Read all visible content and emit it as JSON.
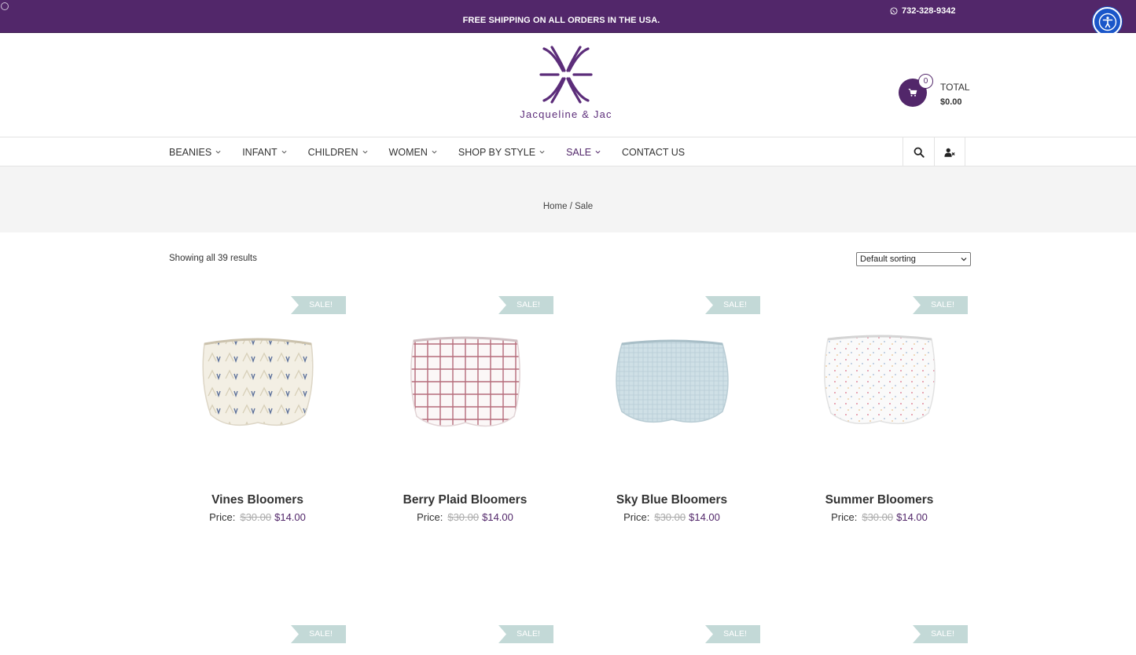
{
  "topbar": {
    "promo": "FREE SHIPPING ON ALL ORDERS IN THE USA.",
    "phone": "732-328-9342",
    "phone_icon": "whatsapp-icon",
    "background": "#52276a"
  },
  "accessibility": {
    "icon": "accessibility-icon",
    "color": "#1a56c9"
  },
  "header": {
    "logo_text": "Jacqueline & Jac",
    "cart": {
      "count": "0",
      "total_label": "TOTAL",
      "total_value": "$0.00",
      "icon": "shopping-cart-icon"
    }
  },
  "nav": {
    "items": [
      {
        "label": "BEANIES",
        "has_dropdown": true
      },
      {
        "label": "INFANT",
        "has_dropdown": true
      },
      {
        "label": "CHILDREN",
        "has_dropdown": true
      },
      {
        "label": "WOMEN",
        "has_dropdown": true
      },
      {
        "label": "SHOP BY STYLE",
        "has_dropdown": true
      },
      {
        "label": "SALE",
        "has_dropdown": true,
        "active": true
      },
      {
        "label": "CONTACT US",
        "has_dropdown": false
      }
    ],
    "tools": [
      "search-icon",
      "user-icon"
    ]
  },
  "breadcrumb": {
    "home": "Home",
    "separator": " / ",
    "current": "Sale"
  },
  "shop": {
    "results_text": "Showing all 39 results",
    "sort_selected": "Default sorting"
  },
  "products": [
    {
      "name": "Vines Bloomers",
      "price_label": "Price:",
      "old_price": "$30.00",
      "new_price": "$14.00",
      "badge": "SALE!"
    },
    {
      "name": "Berry Plaid Bloomers",
      "price_label": "Price:",
      "old_price": "$30.00",
      "new_price": "$14.00",
      "badge": "SALE!"
    },
    {
      "name": "Sky Blue Bloomers",
      "price_label": "Price:",
      "old_price": "$30.00",
      "new_price": "$14.00",
      "badge": "SALE!"
    },
    {
      "name": "Summer Bloomers",
      "price_label": "Price:",
      "old_price": "$30.00",
      "new_price": "$14.00",
      "badge": "SALE!"
    }
  ],
  "next_row_badges": [
    "SALE!",
    "SALE!",
    "SALE!",
    "SALE!"
  ],
  "colors": {
    "brand": "#52276a",
    "sale_badge": "#c3d9d7",
    "breadcrumb_bg": "#f4f4f4"
  }
}
